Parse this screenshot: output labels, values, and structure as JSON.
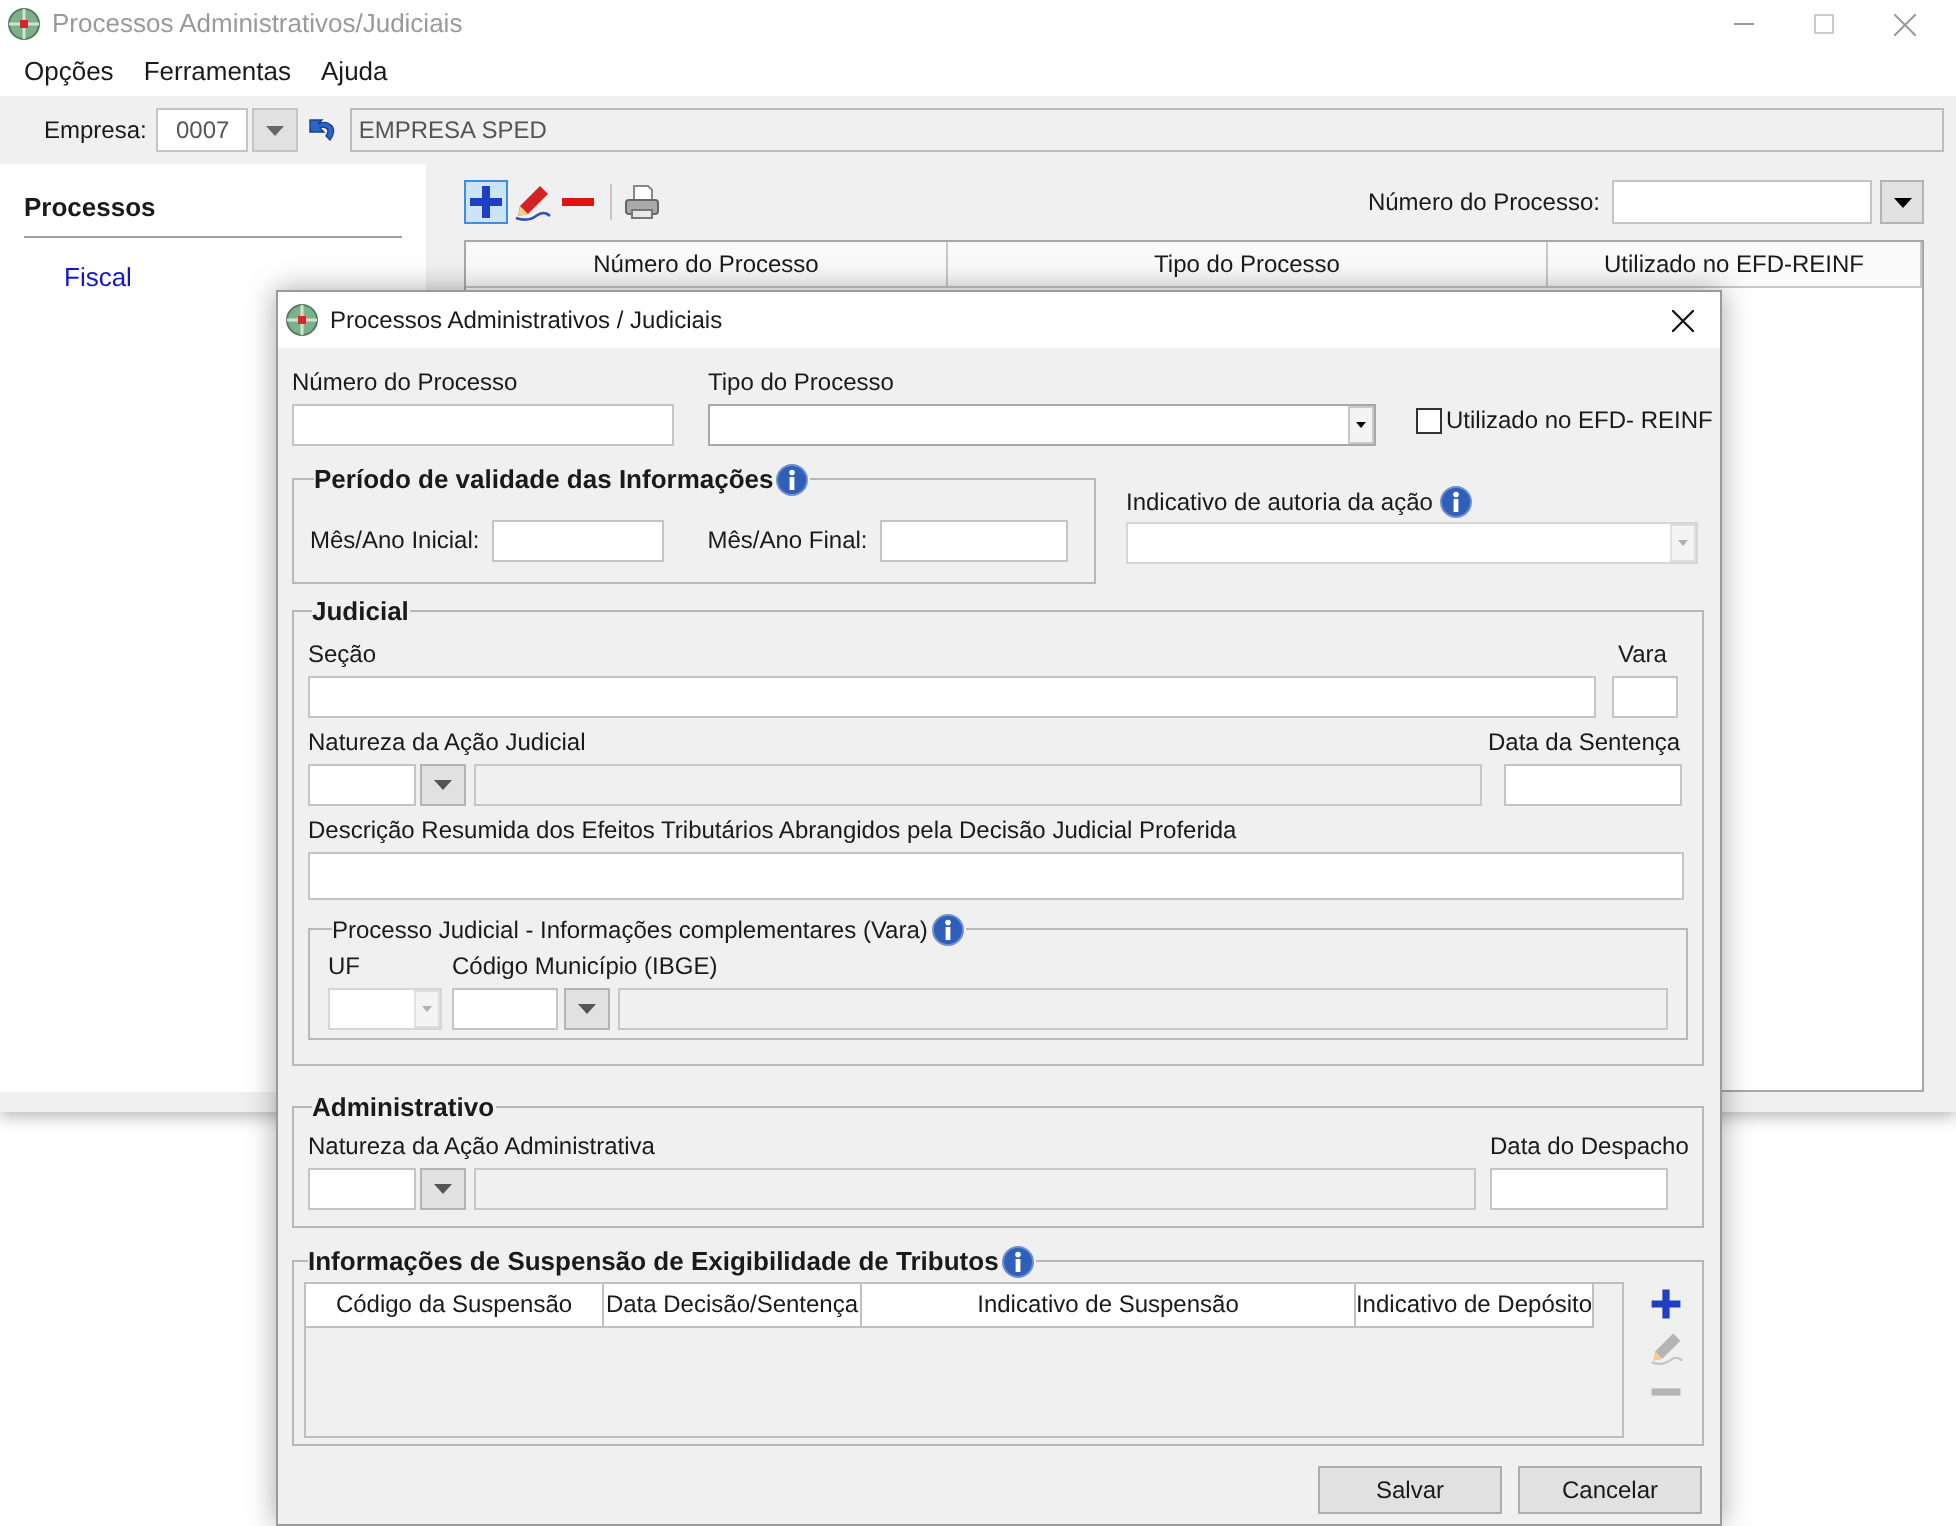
{
  "window": {
    "title": "Processos Administrativos/Judiciais"
  },
  "menu": [
    "Opções",
    "Ferramentas",
    "Ajuda"
  ],
  "company": {
    "label": "Empresa:",
    "code": "0007",
    "name": "EMPRESA SPED"
  },
  "sidebar": {
    "title": "Processos",
    "items": [
      "Fiscal"
    ]
  },
  "toolbar": [
    {
      "kind": "add",
      "highlighted": true
    },
    {
      "kind": "edit",
      "highlighted": false
    },
    {
      "kind": "remove",
      "highlighted": false
    },
    {
      "kind": "print",
      "highlighted": false
    }
  ],
  "search": {
    "label": "Número do Processo:"
  },
  "table": {
    "columns": [
      "Número do Processo",
      "Tipo do Processo",
      "Utilizado no EFD-REINF"
    ]
  },
  "dialog": {
    "title": "Processos Administrativos / Judiciais",
    "numero_label": "Número do Processo",
    "tipo_label": "Tipo do Processo",
    "reinf": {
      "label": "Utilizado no EFD- REINF",
      "checked": false
    },
    "validity": {
      "title": "Período de validade das Informações",
      "start_label": "Mês/Ano Inicial:",
      "end_label": "Mês/Ano Final:"
    },
    "autoria_label": "Indicativo de autoria da ação",
    "judicial": {
      "title": "Judicial",
      "secao_label": "Seção",
      "vara_label": "Vara",
      "natureza_label": "Natureza da Ação Judicial",
      "data_label": "Data da Sentença",
      "descricao_label": "Descrição Resumida dos Efeitos Tributários Abrangidos pela Decisão Judicial Proferida",
      "complement": {
        "title": "Processo Judicial - Informações complementares (Vara)",
        "uf": {
          "label": "UF",
          "disabled": true
        },
        "municipio_label": "Código Município (IBGE)"
      }
    },
    "administrativo": {
      "title": "Administrativo",
      "natureza_label": "Natureza da Ação Administrativa",
      "data_label": "Data do Despacho"
    },
    "suspension": {
      "title": "Informações de Suspensão de Exigibilidade de Tributos",
      "columns": [
        "Código da Suspensão",
        "Data Decisão/Sentença",
        "Indicativo de Suspensão",
        "Indicativo de Depósito"
      ],
      "actions": [
        {
          "kind": "add",
          "disabled": false
        },
        {
          "kind": "edit",
          "disabled": true
        },
        {
          "kind": "remove",
          "disabled": true
        }
      ]
    },
    "buttons": [
      "Salvar",
      "Cancelar"
    ]
  }
}
